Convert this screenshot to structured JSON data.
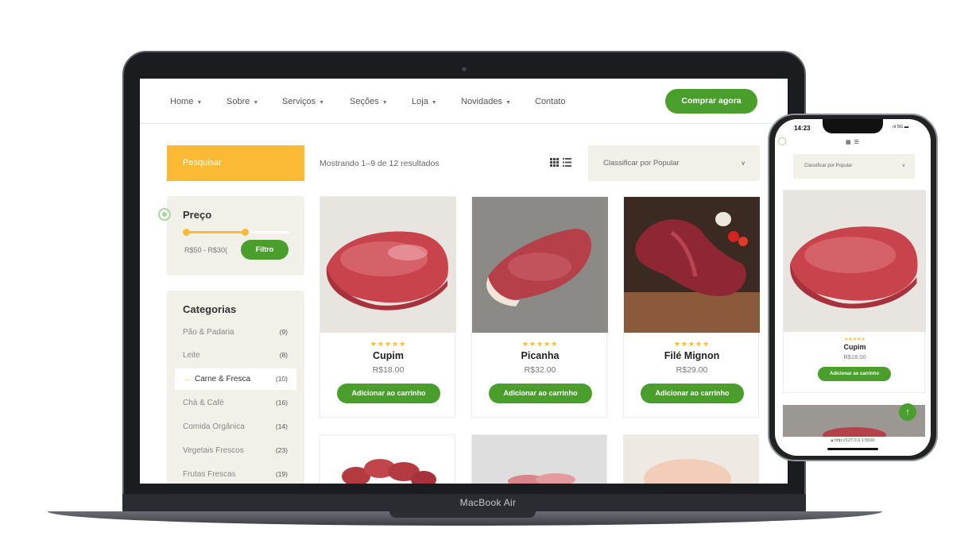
{
  "laptop": {
    "brand_label": "MacBook Air",
    "nav": {
      "items": [
        {
          "label": "Home",
          "has_dropdown": true
        },
        {
          "label": "Sobre",
          "has_dropdown": true
        },
        {
          "label": "Serviços",
          "has_dropdown": true
        },
        {
          "label": "Seções",
          "has_dropdown": true
        },
        {
          "label": "Loja",
          "has_dropdown": true
        },
        {
          "label": "Novidades",
          "has_dropdown": true
        },
        {
          "label": "Contato",
          "has_dropdown": false
        }
      ],
      "cta_label": "Comprar agora"
    },
    "sidebar": {
      "search_label": "Pesquisar",
      "price": {
        "title": "Preço",
        "range_text": "R$50 - R$30(",
        "filter_label": "Filtro"
      },
      "categories": {
        "title": "Categorias",
        "items": [
          {
            "label": "Pão & Padaria",
            "count": "(9)"
          },
          {
            "label": "Leite",
            "count": "(8)"
          },
          {
            "label": "Carne & Fresca",
            "count": "(10)",
            "active": true
          },
          {
            "label": "Chá & Café",
            "count": "(16)"
          },
          {
            "label": "Comida Orgânica",
            "count": "(14)"
          },
          {
            "label": "Vegetais Frescos",
            "count": "(23)"
          },
          {
            "label": "Frutas Frescas",
            "count": "(19)"
          }
        ]
      }
    },
    "toolbar": {
      "showing_text": "Mostrando 1–9 de 12 resultados",
      "sort_label": "Classificar por Popular"
    },
    "products": [
      {
        "name": "Cupim",
        "price": "R$18.00",
        "stars": "★★★★★",
        "cart_label": "Adicionar ao carrinho"
      },
      {
        "name": "Picanha",
        "price": "R$32.00",
        "stars": "★★★★★",
        "cart_label": "Adicionar ao carrinho"
      },
      {
        "name": "Filé Mignon",
        "price": "R$29.00",
        "stars": "★★★★★",
        "cart_label": "Adicionar ao carrinho"
      }
    ],
    "back_to_top": "↑"
  },
  "phone": {
    "time": "14:23",
    "signal": "5G",
    "sort_label": "Classificar por Popular",
    "product": {
      "name": "Cupim",
      "price": "R$18.00",
      "stars": "★★★★★",
      "cart_label": "Adicionar ao carrinho"
    },
    "url": "http://127.0.0.1:5500",
    "back_to_top": "↑"
  },
  "colors": {
    "primary_green": "#4a9e2c",
    "accent_yellow": "#fbba36",
    "panel_bg": "#f1f1ea"
  }
}
